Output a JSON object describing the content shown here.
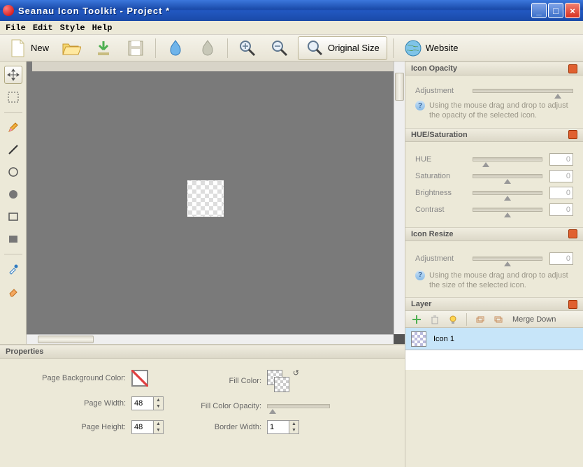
{
  "window": {
    "title": "Seanau Icon Toolkit - Project *"
  },
  "menu": {
    "file": "File",
    "edit": "Edit",
    "style": "Style",
    "help": "Help"
  },
  "toolbar": {
    "new": "New",
    "original_size": "Original Size",
    "website": "Website"
  },
  "panels": {
    "icon_opacity": {
      "title": "Icon Opacity",
      "adjustment_label": "Adjustment",
      "hint": "Using the mouse drag and drop to adjust the opacity of the selected icon."
    },
    "hue_saturation": {
      "title": "HUE/Saturation",
      "hue_label": "HUE",
      "hue_value": "0",
      "saturation_label": "Saturation",
      "saturation_value": "0",
      "brightness_label": "Brightness",
      "brightness_value": "0",
      "contrast_label": "Contrast",
      "contrast_value": "0"
    },
    "icon_resize": {
      "title": "Icon Resize",
      "adjustment_label": "Adjustment",
      "value": "0",
      "hint": "Using the mouse drag and drop to adjust the size of the selected icon."
    },
    "layer": {
      "title": "Layer",
      "merge_down": "Merge Down",
      "items": [
        {
          "name": "Icon 1"
        }
      ]
    }
  },
  "properties": {
    "title": "Properties",
    "bg_color_label": "Page Background Color:",
    "page_width_label": "Page Width:",
    "page_width": "48",
    "page_height_label": "Page Height:",
    "page_height": "48",
    "fill_color_label": "Fill Color:",
    "fill_opacity_label": "Fill Color Opacity:",
    "border_width_label": "Border Width:",
    "border_width": "1"
  }
}
